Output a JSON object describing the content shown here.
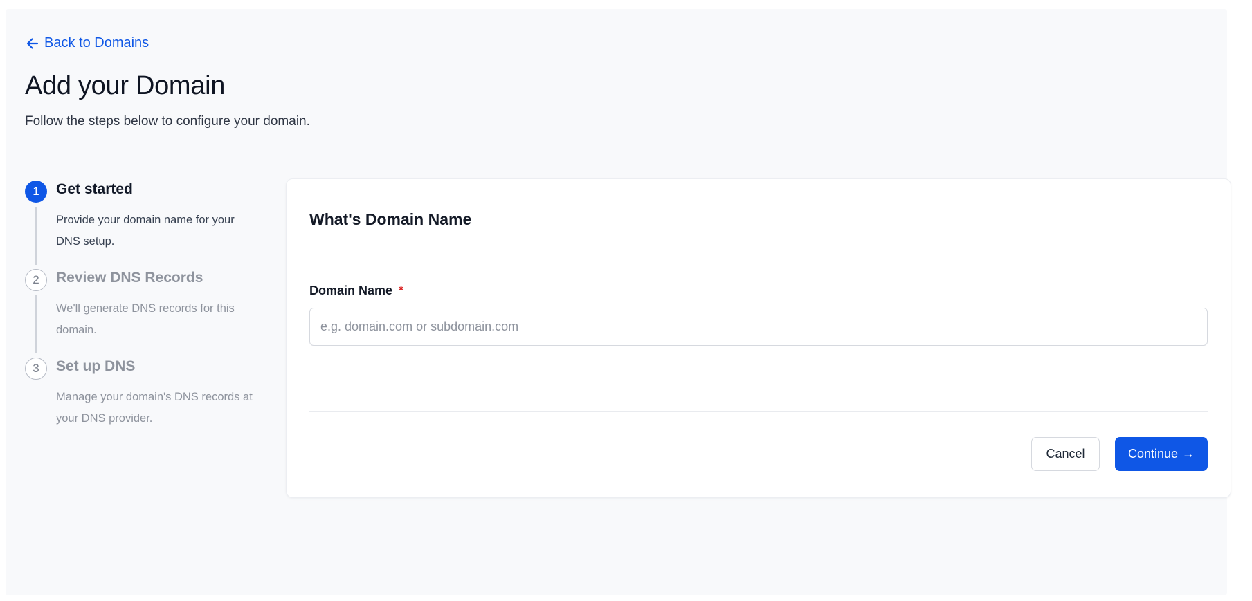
{
  "nav": {
    "back_label": "Back to Domains"
  },
  "header": {
    "title": "Add your Domain",
    "subtitle": "Follow the steps below to configure your domain."
  },
  "steps": [
    {
      "number": "1",
      "title": "Get started",
      "description": "Provide your domain name for your DNS setup.",
      "state": "active"
    },
    {
      "number": "2",
      "title": "Review DNS Records",
      "description": "We'll generate DNS records for this domain.",
      "state": "inactive"
    },
    {
      "number": "3",
      "title": "Set up DNS",
      "description": "Manage your domain's DNS records at your DNS provider.",
      "state": "inactive"
    }
  ],
  "form": {
    "title": "What's Domain Name",
    "field_label": "Domain Name",
    "required_marker": "*",
    "input_value": "",
    "input_placeholder": "e.g. domain.com or subdomain.com",
    "cancel_label": "Cancel",
    "continue_label": "Continue",
    "continue_arrow": "→"
  },
  "icons": {
    "back": "arrow-left-icon"
  },
  "colors": {
    "accent": "#0f57e6",
    "required": "#dc2626",
    "page_background": "#f8f9fb",
    "muted_text": "#8e939d"
  }
}
